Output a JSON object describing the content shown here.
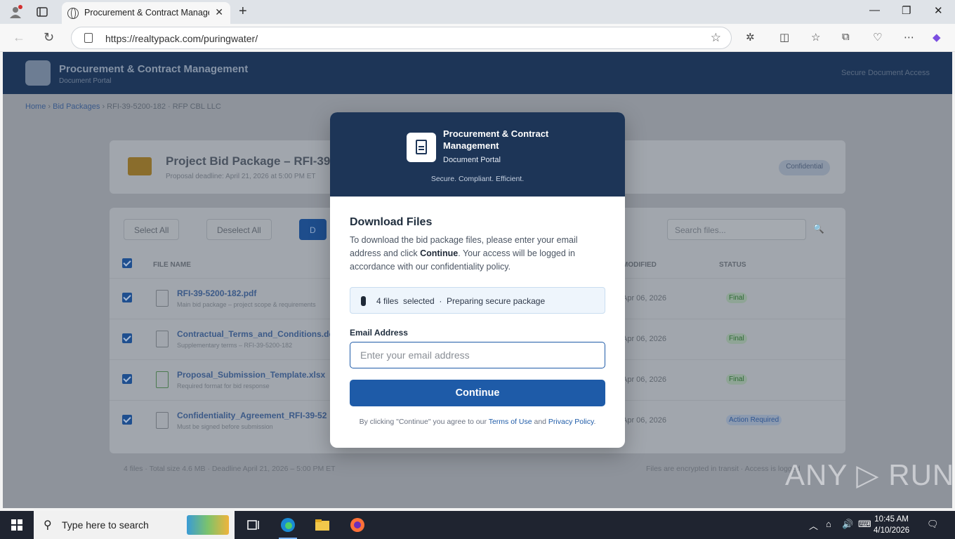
{
  "browser": {
    "tab_title": "Procurement & Contract Management",
    "url": "https://realtypack.com/puringwater/",
    "new_tab": "+",
    "tab_close": "✕",
    "min": "—",
    "max": "❐",
    "close": "✕"
  },
  "page": {
    "header_title": "Procurement & Contract Management",
    "header_sub": "Document Portal",
    "header_right": "Secure Document Access",
    "breadcrumb": [
      "Home",
      "Bid Packages",
      "RFI-39-5200-182 · RFP CBL LLC"
    ],
    "package_title": "Project Bid Package – RFI-39",
    "package_sub": "Proposal deadline: April 21, 2026 at 5:00 PM ET",
    "confidential": "Confidential",
    "select_all": "Select All",
    "deselect_all": "Deselect All",
    "download_btn": "D",
    "search_placeholder": "Search files...",
    "col_file": "FILE NAME",
    "col_modified": "MODIFIED",
    "col_status": "STATUS",
    "files": [
      {
        "name": "RFI-39-5200-182.pdf",
        "desc": "Main bid package – project scope & requirements",
        "date": "Apr 06, 2026",
        "status": "Final"
      },
      {
        "name": "Contractual_Terms_and_Conditions.docx",
        "desc": "Supplementary terms – RFI-39-5200-182",
        "date": "Apr 06, 2026",
        "status": "Final"
      },
      {
        "name": "Proposal_Submission_Template.xlsx",
        "desc": "Required format for bid response",
        "date": "Apr 06, 2026",
        "status": "Final"
      },
      {
        "name": "Confidentiality_Agreement_RFI-39-52",
        "desc": "Must be signed before submission",
        "date": "Apr 06, 2026",
        "status": "Action Required"
      }
    ],
    "footer_left": "4 files · Total size 4.6 MB · Deadline April 21, 2026 – 5:00 PM ET",
    "footer_right": "Files are encrypted in transit · Access is logged"
  },
  "modal": {
    "title": "Procurement & Contract Management",
    "subtitle": "Document Portal",
    "tagline": "Secure. Compliant. Efficient.",
    "heading": "Download Files",
    "intro_1": "To download the bid package files, please enter your email address and click ",
    "intro_bold": "Continue",
    "intro_2": ". Your access will be logged in accordance with our confidentiality policy.",
    "status": "4 files  selected  ·  Preparing secure package",
    "email_label": "Email Address",
    "email_placeholder": "Enter your email address",
    "continue": "Continue",
    "footer_1": "By clicking \"Continue\" you agree to our ",
    "terms": "Terms of Use",
    "footer_and": " and ",
    "privacy": "Privacy Policy",
    "footer_end": "."
  },
  "watermark": "ANY ▷ RUN",
  "taskbar": {
    "search_text": "Type here to search",
    "time": "10:45 AM",
    "date": "4/10/2026"
  },
  "colors": {
    "navy": "#1d3557",
    "primary": "#1e5ba8",
    "status_final": "#2e7d32",
    "status_action": "#1e5ba8"
  }
}
